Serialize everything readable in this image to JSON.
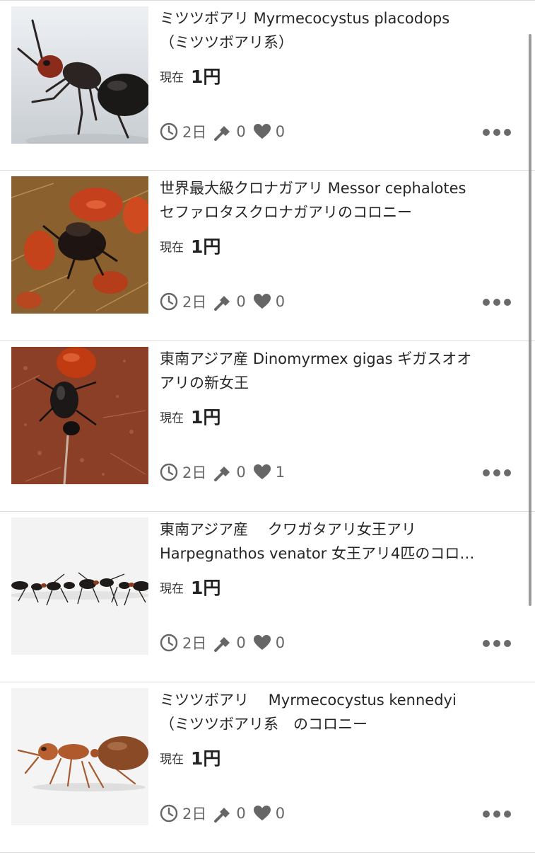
{
  "price_label": "現在",
  "listings": [
    {
      "title_line1": "ミツツボアリ Myrmecocystus placodops",
      "title_line2": "（ミツツボアリ系）",
      "price": "1円",
      "time_left": "2日",
      "bids": "0",
      "likes": "0",
      "image": "honeypot-ant-black-photo"
    },
    {
      "title_line1": "世界最大級クロナガアリ Messor cephalotes",
      "title_line2": "セファロタスクロナガアリのコロニー",
      "price": "1円",
      "time_left": "2日",
      "bids": "0",
      "likes": "0",
      "image": "red-harvester-ant-colony-photo"
    },
    {
      "title_line1": "東南アジア産 Dinomyrmex gigas ギガスオオ",
      "title_line2": "アリの新女王",
      "price": "1円",
      "time_left": "2日",
      "bids": "0",
      "likes": "1",
      "image": "giant-ant-queen-on-soil-photo"
    },
    {
      "title_line1": "東南アジア産　 クワガタアリ女王アリ",
      "title_line2": "Harpegnathos venator 女王アリ4匹のコロ…",
      "price": "1円",
      "time_left": "2日",
      "bids": "0",
      "likes": "0",
      "image": "jumping-ants-in-row-photo"
    },
    {
      "title_line1": "ミツツボアリ　 Myrmecocystus kennedyi",
      "title_line2": "（ミツツボアリ系　のコロニー",
      "price": "1円",
      "time_left": "2日",
      "bids": "0",
      "likes": "0",
      "image": "honeypot-ant-orange-photo"
    }
  ],
  "icons": {
    "time": "clock-icon",
    "bids": "gavel-icon",
    "likes": "heart-icon",
    "more": "more-dots-icon"
  },
  "colors": {
    "text": "#262626",
    "meta": "#666666",
    "divider": "#dcdcdc"
  }
}
